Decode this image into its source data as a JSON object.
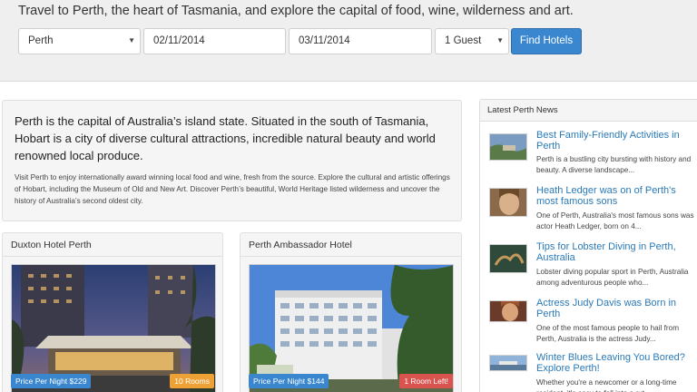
{
  "search_bar": {
    "tagline": "Travel to Perth, the heart of Tasmania, and explore the capital of food, wine, wilderness and art.",
    "destination": "Perth",
    "check_in": "02/11/2014",
    "check_out": "03/11/2014",
    "guests": "1 Guest",
    "find_button": "Find Hotels"
  },
  "intro": {
    "lead": "Perth is the capital of Australia’s island state. Situated in the south of Tasmania, Hobart is a city of diverse cultural attractions, incredible natural beauty and world renowned local produce.",
    "body": "Visit Perth to enjoy internationally award winning local food and wine, fresh from the source. Explore the cultural and artistic offerings of Hobart, including the Museum of Old and New Art. Discover Perth’s beautiful, World Heritage listed wilderness and uncover the history of Australia’s second oldest city."
  },
  "hotels": [
    {
      "name": "Duxton Hotel Perth",
      "price": "Price Per Night $229",
      "availability": "10 Rooms",
      "availability_color": "#eea236"
    },
    {
      "name": "Perth Ambassador Hotel",
      "price": "Price Per Night $144",
      "availability": "1 Room Left!",
      "availability_color": "#d9534f"
    }
  ],
  "news": {
    "header": "Latest Perth News",
    "items": [
      {
        "title": "Best Family-Friendly Activities in Perth",
        "excerpt": "Perth is a bustling city bursting with history and beauty. A diverse landscape..."
      },
      {
        "title": "Heath Ledger was on of Perth's most famous sons",
        "excerpt": "One of Perth, Australia's most famous sons was actor Heath Ledger, born on 4..."
      },
      {
        "title": "Tips for Lobster Diving in Perth, Australia",
        "excerpt": "Lobster diving popular sport in Perth, Australia among adventurous people who..."
      },
      {
        "title": "Actress Judy Davis was Born in Perth",
        "excerpt": "One of the most famous people to hail from Perth, Australia is the actress Judy..."
      },
      {
        "title": "Winter Blues Leaving You Bored? Explore Perth!",
        "excerpt": "Whether you're a newcomer or a long-time resident, it's easy to fall into a rut..."
      }
    ]
  },
  "colors": {
    "accent": "#3a87cf",
    "link": "#2a7ab8",
    "badge_orange": "#eea236",
    "badge_red": "#d9534f"
  }
}
